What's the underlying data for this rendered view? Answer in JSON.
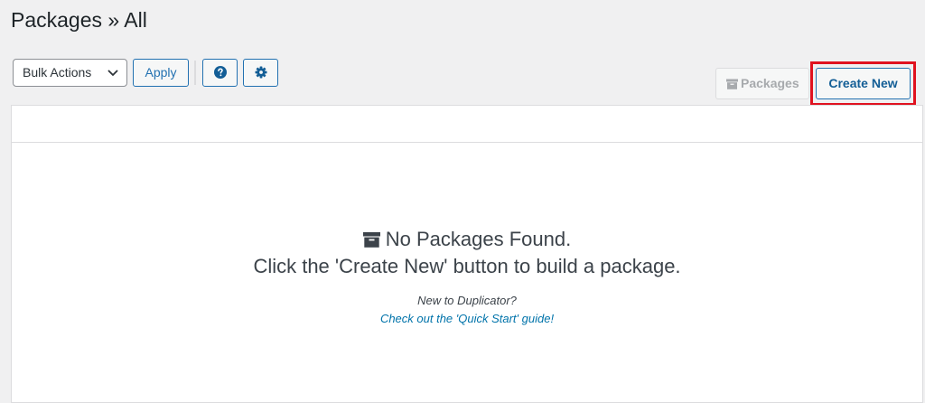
{
  "header": {
    "title": "Packages » All"
  },
  "toolbar": {
    "bulk_actions": {
      "selected": "Bulk Actions",
      "icon": "chevron-down-icon"
    },
    "apply_label": "Apply",
    "help_icon": "question-circle-icon",
    "settings_icon": "gear-icon"
  },
  "actions": {
    "packages_label": "Packages",
    "packages_icon": "archive-icon",
    "create_new_label": "Create New",
    "highlight_color": "#e0121f"
  },
  "empty_state": {
    "icon": "archive-icon",
    "title": "No Packages Found.",
    "subtitle": "Click the 'Create New' button to build a package.",
    "new_to": "New to Duplicator?",
    "guide_link": "Check out the 'Quick Start' guide!"
  },
  "colors": {
    "accent": "#2271b1",
    "link": "#0073aa",
    "background": "#f0f0f1"
  }
}
